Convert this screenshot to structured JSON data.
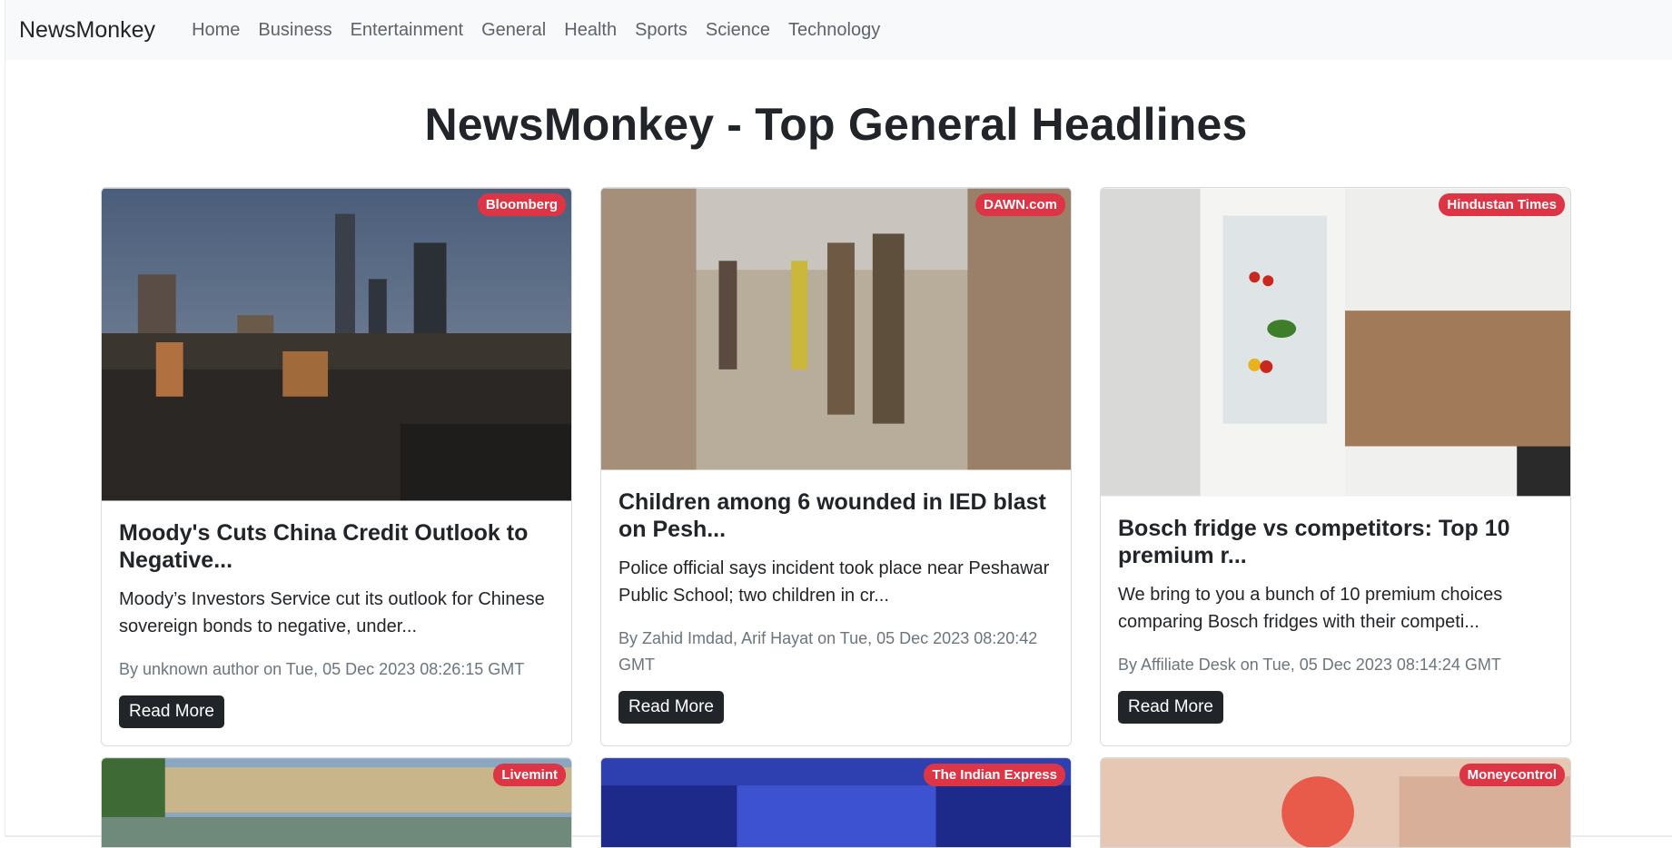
{
  "nav": {
    "brand": "NewsMonkey",
    "links": [
      "Home",
      "Business",
      "Entertainment",
      "General",
      "Health",
      "Sports",
      "Science",
      "Technology"
    ]
  },
  "page_title": "NewsMonkey - Top General Headlines",
  "cards": [
    {
      "source": "Bloomberg",
      "title": "Moody's Cuts China Credit Outlook to Negative...",
      "description": "Moody’s Investors Service cut its outlook for Chinese sovereign bonds to negative, under...",
      "meta": "By unknown author on Tue, 05 Dec 2023 08:26:15 GMT",
      "button": "Read More"
    },
    {
      "source": "DAWN.com",
      "title": "Children among 6 wounded in IED blast on Pesh...",
      "description": "Police official says incident took place near Peshawar Public School; two children in cr...",
      "meta": "By Zahid Imdad, Arif Hayat on Tue, 05 Dec 2023 08:20:42 GMT",
      "button": "Read More"
    },
    {
      "source": "Hindustan Times",
      "title": "Bosch fridge vs competitors: Top 10 premium r...",
      "description": "We bring to you a bunch of 10 premium choices comparing Bosch fridges with their competi...",
      "meta": "By Affiliate Desk on Tue, 05 Dec 2023 08:14:24 GMT",
      "button": "Read More"
    }
  ],
  "next_row_sources": [
    "Livemint",
    "The Indian Express",
    "Moneycontrol"
  ],
  "colors": {
    "badge": "#dc3545",
    "button": "#212529",
    "navbar": "#f8f9fa"
  }
}
